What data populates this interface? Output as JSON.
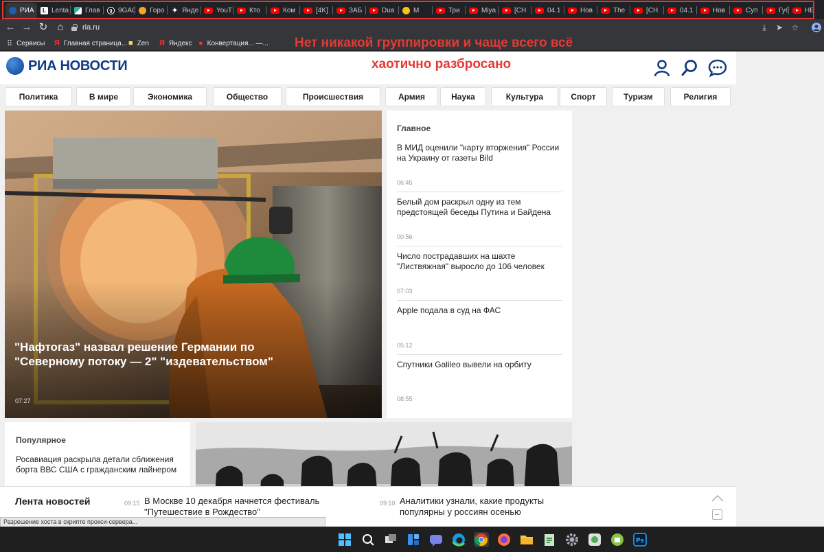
{
  "browser": {
    "tabs": [
      {
        "title": "РИА",
        "icon": "ria-favicon",
        "active": true,
        "close": "✕"
      },
      {
        "title": "Lenta",
        "icon": "lenta-favicon"
      },
      {
        "title": "Глав",
        "icon": "glavred-favicon"
      },
      {
        "title": "9GAG",
        "icon": "9gag-favicon"
      },
      {
        "title": "Горо",
        "icon": "goroskop-favicon"
      },
      {
        "title": "Янде",
        "icon": "yandex-zen-favicon"
      },
      {
        "title": "YouT",
        "icon": "youtube-favicon"
      },
      {
        "title": "Кто",
        "icon": "youtube-favicon"
      },
      {
        "title": "Ком",
        "icon": "youtube-favicon"
      },
      {
        "title": "[4K]",
        "icon": "youtube-favicon"
      },
      {
        "title": "ЗАБ",
        "icon": "youtube-favicon"
      },
      {
        "title": "Dua",
        "icon": "youtube-favicon"
      },
      {
        "title": "M",
        "icon": "emoji-favicon"
      },
      {
        "title": "Три",
        "icon": "youtube-favicon"
      },
      {
        "title": "Miya",
        "icon": "youtube-favicon"
      },
      {
        "title": "[CH",
        "icon": "youtube-favicon"
      },
      {
        "title": "04.1",
        "icon": "youtube-favicon"
      },
      {
        "title": "Нов",
        "icon": "youtube-favicon"
      },
      {
        "title": "The",
        "icon": "youtube-favicon"
      },
      {
        "title": "[CH",
        "icon": "youtube-favicon"
      },
      {
        "title": "04.1",
        "icon": "youtube-favicon"
      },
      {
        "title": "Нов",
        "icon": "youtube-favicon"
      },
      {
        "title": "Суп",
        "icon": "youtube-favicon"
      },
      {
        "title": "Губ",
        "icon": "youtube-favicon"
      },
      {
        "title": "НЕР",
        "icon": "youtube-favicon"
      }
    ],
    "url": "ria.ru",
    "bookmarks": [
      {
        "label": "Сервисы",
        "icon": "apps-grid-icon"
      },
      {
        "label": "Главная страница...",
        "icon": "yandex-icon"
      },
      {
        "label": "Zen",
        "icon": "folder-icon"
      },
      {
        "label": "Яндекс",
        "icon": "yandex-icon"
      },
      {
        "label": "Конвертация... —...",
        "icon": "converter-icon"
      }
    ],
    "status_text": "Разрешение хоста в скрипте прокси-сервера..."
  },
  "annotation": {
    "line1": "Нет никакой группировки и чаще всего всё",
    "line2": "хаотично разбросано"
  },
  "site": {
    "logo": "РИА НОВОСТИ",
    "menu": [
      "Политика",
      "В мире",
      "Экономика",
      "Общество",
      "Происшествия",
      "Армия",
      "Наука",
      "Культура",
      "Спорт",
      "Туризм",
      "Религия"
    ],
    "hero": {
      "title": "\"Нафтогаз\" назвал решение Германии по \"Северному потоку — 2\" \"издевательством\"",
      "time": "07:27"
    },
    "main_news": {
      "title": "Главное",
      "items": [
        {
          "text": "В МИД оценили \"карту вторжения\" России на Украину от газеты Bild",
          "time": "06:45"
        },
        {
          "text": "Белый дом раскрыл одну из тем предстоящей беседы Путина и Байдена",
          "time": "00:56"
        },
        {
          "text": "Число пострадавших на шахте \"Листвяжная\" выросло до 106 человек",
          "time": "07:03"
        },
        {
          "text": "Apple подала в суд на ФАС",
          "time": "05:12"
        },
        {
          "text": "Спутники Galileo вывели на орбиту",
          "time": "08:55"
        }
      ]
    },
    "popular": {
      "title": "Популярное",
      "text": "Росавиация раскрыла детали сближения борта ВВС США с гражданским лайнером"
    },
    "lenta": {
      "title": "Лента новостей",
      "items": [
        {
          "time": "09:15",
          "text": "В Москве 10 декабря начнется фестиваль \"Путешествие в Рождество\""
        },
        {
          "time": "09:10",
          "text": "Аналитики узнали, какие продукты популярны у россиян осенью"
        }
      ]
    }
  },
  "colors": {
    "annotation": "#e53935",
    "brand": "#0f3b82",
    "helmet": "#1e8a3c"
  }
}
